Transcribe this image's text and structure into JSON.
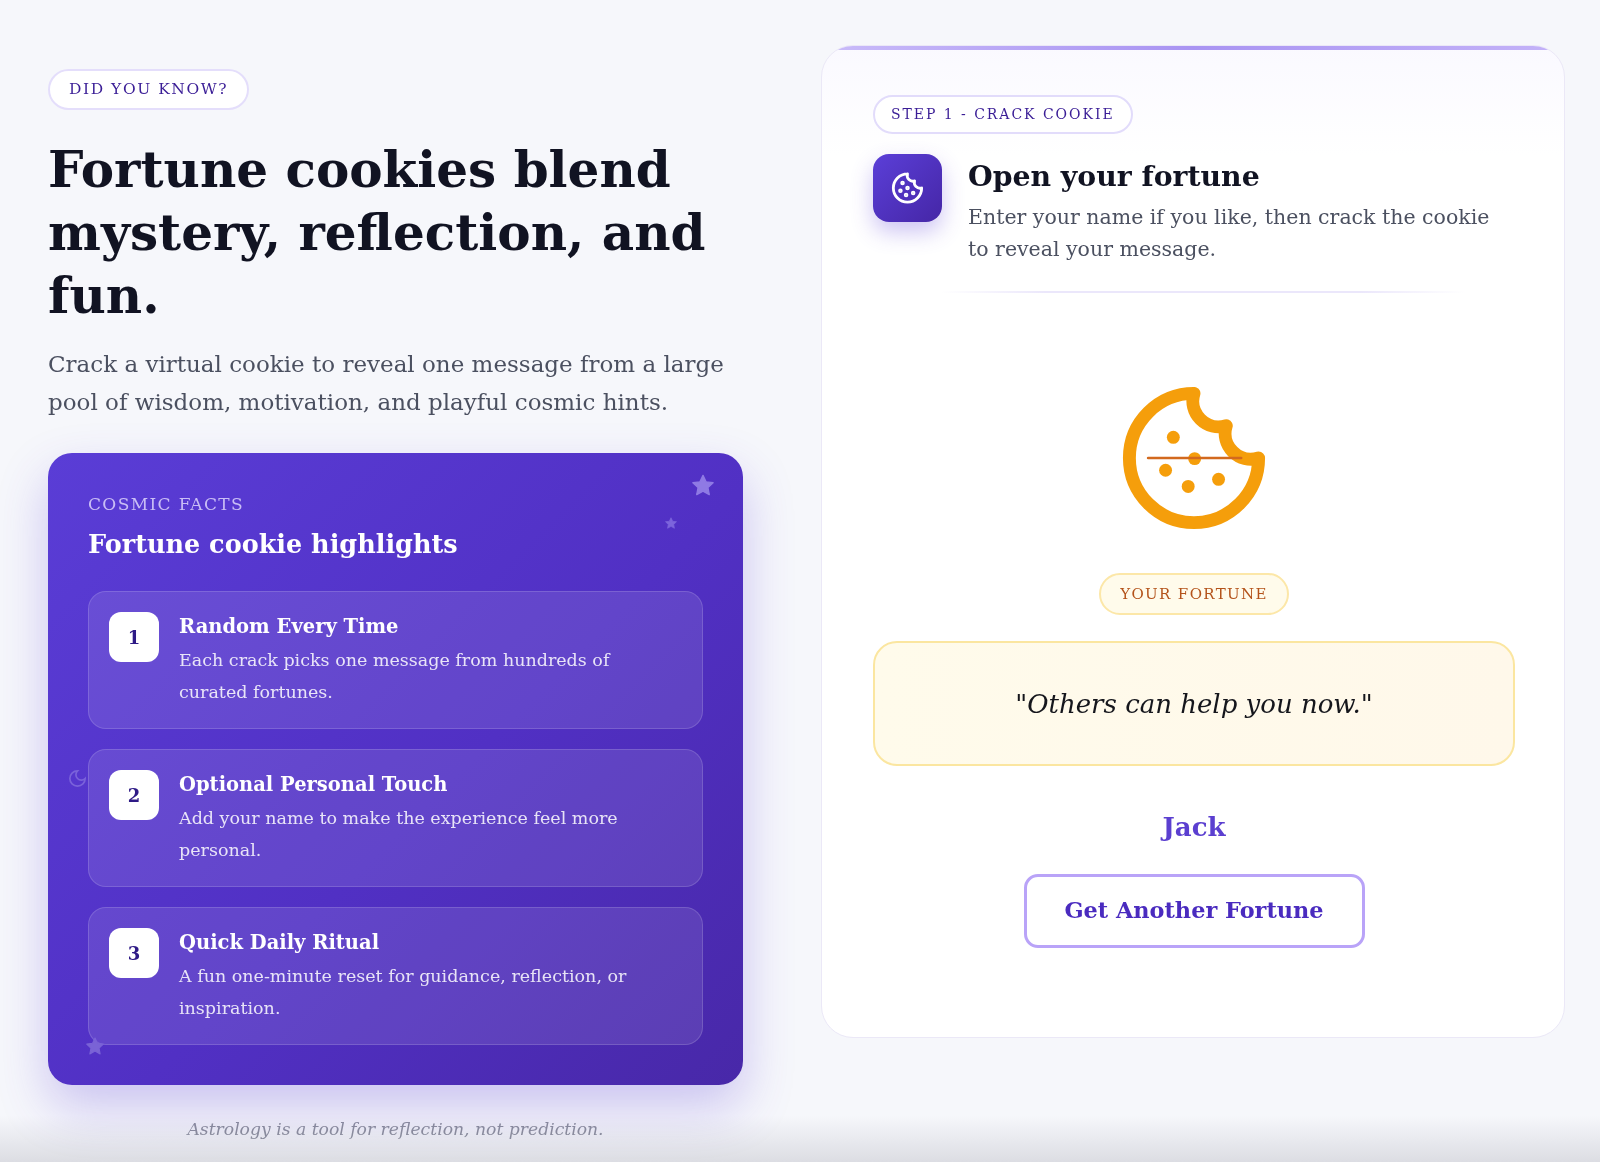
{
  "intro": {
    "badge": "DID YOU KNOW?",
    "headline": "Fortune cookies blend mystery, reflection, and fun.",
    "description": "Crack a virtual cookie to reveal one message from a large pool of wisdom, motivation, and playful cosmic hints."
  },
  "facts_card": {
    "eyebrow": "COSMIC FACTS",
    "title": "Fortune cookie highlights",
    "items": [
      {
        "number": "1",
        "title": "Random Every Time",
        "description": "Each crack picks one message from hundreds of curated fortunes."
      },
      {
        "number": "2",
        "title": "Optional Personal Touch",
        "description": "Add your name to make the experience feel more personal."
      },
      {
        "number": "3",
        "title": "Quick Daily Ritual",
        "description": "A fun one-minute reset for guidance, reflection, or inspiration."
      }
    ]
  },
  "footnote": "Astrology is a tool for reflection, not prediction.",
  "fortune_card": {
    "step_badge": "STEP 1 - CRACK COOKIE",
    "title": "Open your fortune",
    "description": "Enter your name if you like, then crack the cookie to reveal your message.",
    "fortune_label": "YOUR FORTUNE",
    "fortune_text": "\"Others can help you now.\"",
    "name": "Jack",
    "button": "Get Another Fortune"
  }
}
